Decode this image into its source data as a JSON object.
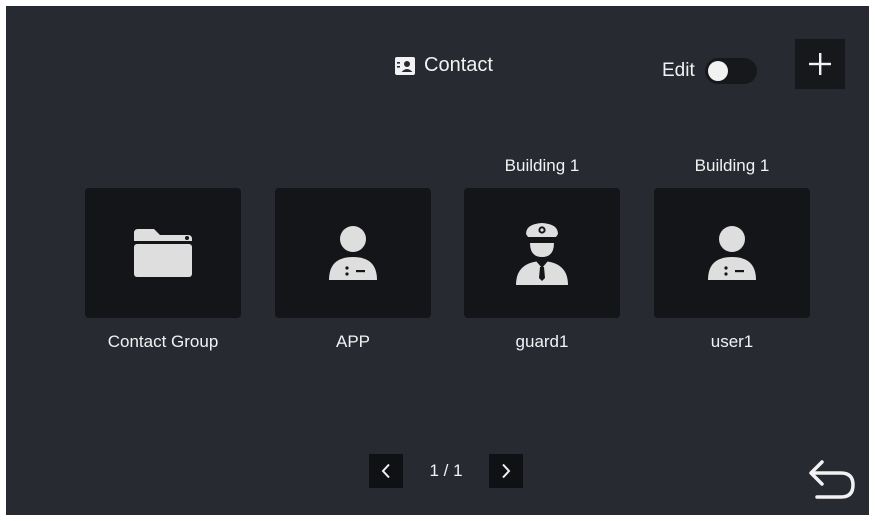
{
  "header": {
    "title": "Contact",
    "title_icon": "contact-card-icon",
    "edit_label": "Edit",
    "edit_toggle_on": false,
    "add_icon": "plus-icon"
  },
  "contacts": [
    {
      "top_label": "",
      "label": "Contact Group",
      "icon": "folder-icon"
    },
    {
      "top_label": "",
      "label": "APP",
      "icon": "user-icon"
    },
    {
      "top_label": "Building 1",
      "label": "guard1",
      "icon": "guard-icon"
    },
    {
      "top_label": "Building 1",
      "label": "user1",
      "icon": "user-icon"
    }
  ],
  "pagination": {
    "text": "1 / 1",
    "prev_icon": "chevron-left-icon",
    "next_icon": "chevron-right-icon"
  },
  "back_icon": "back-arrow-icon",
  "colors": {
    "background": "#272a30",
    "tile": "#141518",
    "icon": "#dedede",
    "text": "#f2f2f2"
  }
}
